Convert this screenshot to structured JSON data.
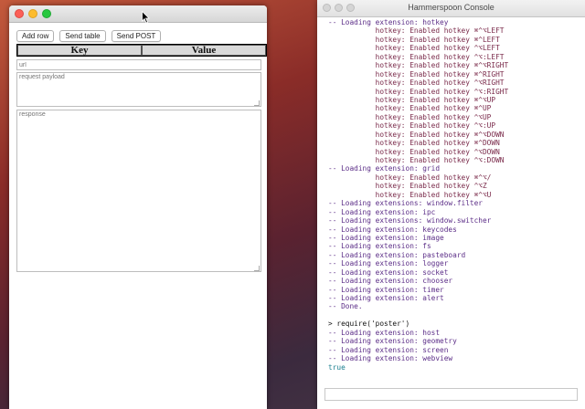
{
  "colors": {
    "close": "#fc5f57",
    "minimize": "#fdbc2e",
    "maximize": "#28c840",
    "log_text": "#5b2d87",
    "hotkey_text": "#7a2a4a",
    "result_text": "#1a7f8f"
  },
  "poster": {
    "toolbar": {
      "add_row": "Add row",
      "send_table": "Send table",
      "send_post": "Send POST"
    },
    "table": {
      "key_header": "Key",
      "value_header": "Value"
    },
    "url_placeholder": "url",
    "payload_placeholder": "request payload",
    "response_placeholder": "response"
  },
  "console": {
    "title": "Hammerspoon Console",
    "lines": [
      {
        "kind": "log",
        "text": "-- Loading extension: hotkey"
      },
      {
        "kind": "hot",
        "text": "           hotkey: Enabled hotkey ⌘^⌥LEFT"
      },
      {
        "kind": "hot",
        "text": "           hotkey: Enabled hotkey ⌘^LEFT"
      },
      {
        "kind": "hot",
        "text": "           hotkey: Enabled hotkey ^⌥LEFT"
      },
      {
        "kind": "hot",
        "text": "           hotkey: Enabled hotkey ^⌥:LEFT"
      },
      {
        "kind": "hot",
        "text": "           hotkey: Enabled hotkey ⌘^⌥RIGHT"
      },
      {
        "kind": "hot",
        "text": "           hotkey: Enabled hotkey ⌘^RIGHT"
      },
      {
        "kind": "hot",
        "text": "           hotkey: Enabled hotkey ^⌥RIGHT"
      },
      {
        "kind": "hot",
        "text": "           hotkey: Enabled hotkey ^⌥:RIGHT"
      },
      {
        "kind": "hot",
        "text": "           hotkey: Enabled hotkey ⌘^⌥UP"
      },
      {
        "kind": "hot",
        "text": "           hotkey: Enabled hotkey ⌘^UP"
      },
      {
        "kind": "hot",
        "text": "           hotkey: Enabled hotkey ^⌥UP"
      },
      {
        "kind": "hot",
        "text": "           hotkey: Enabled hotkey ^⌥:UP"
      },
      {
        "kind": "hot",
        "text": "           hotkey: Enabled hotkey ⌘^⌥DOWN"
      },
      {
        "kind": "hot",
        "text": "           hotkey: Enabled hotkey ⌘^DOWN"
      },
      {
        "kind": "hot",
        "text": "           hotkey: Enabled hotkey ^⌥DOWN"
      },
      {
        "kind": "hot",
        "text": "           hotkey: Enabled hotkey ^⌥:DOWN"
      },
      {
        "kind": "log",
        "text": "-- Loading extension: grid"
      },
      {
        "kind": "hot",
        "text": "           hotkey: Enabled hotkey ⌘^⌥/"
      },
      {
        "kind": "hot",
        "text": "           hotkey: Enabled hotkey ^⌥Z"
      },
      {
        "kind": "hot",
        "text": "           hotkey: Enabled hotkey ⌘^⌥U"
      },
      {
        "kind": "log",
        "text": "-- Loading extensions: window.filter"
      },
      {
        "kind": "log",
        "text": "-- Loading extension: ipc"
      },
      {
        "kind": "log",
        "text": "-- Loading extensions: window.switcher"
      },
      {
        "kind": "log",
        "text": "-- Loading extension: keycodes"
      },
      {
        "kind": "log",
        "text": "-- Loading extension: image"
      },
      {
        "kind": "log",
        "text": "-- Loading extension: fs"
      },
      {
        "kind": "log",
        "text": "-- Loading extension: pasteboard"
      },
      {
        "kind": "log",
        "text": "-- Loading extension: logger"
      },
      {
        "kind": "log",
        "text": "-- Loading extension: socket"
      },
      {
        "kind": "log",
        "text": "-- Loading extension: chooser"
      },
      {
        "kind": "log",
        "text": "-- Loading extension: timer"
      },
      {
        "kind": "log",
        "text": "-- Loading extension: alert"
      },
      {
        "kind": "log",
        "text": "-- Done."
      },
      {
        "kind": "blank",
        "text": ""
      },
      {
        "kind": "cmd",
        "text": "> require('poster')"
      },
      {
        "kind": "log",
        "text": "-- Loading extension: host"
      },
      {
        "kind": "log",
        "text": "-- Loading extension: geometry"
      },
      {
        "kind": "log",
        "text": "-- Loading extension: screen"
      },
      {
        "kind": "log",
        "text": "-- Loading extension: webview"
      },
      {
        "kind": "res",
        "text": "true"
      }
    ]
  }
}
